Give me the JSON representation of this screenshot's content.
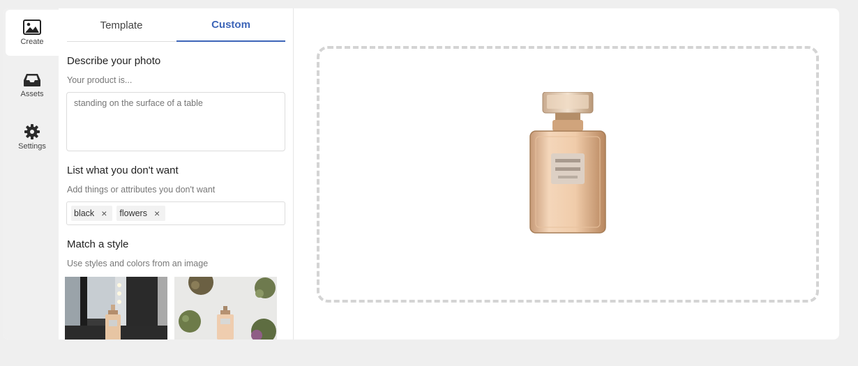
{
  "rail": {
    "items": [
      {
        "label": "Create",
        "icon": "image-icon",
        "active": true
      },
      {
        "label": "Assets",
        "icon": "inbox-icon",
        "active": false
      },
      {
        "label": "Settings",
        "icon": "gear-icon",
        "active": false
      }
    ]
  },
  "tabs": [
    {
      "label": "Template",
      "active": false
    },
    {
      "label": "Custom",
      "active": true
    }
  ],
  "describe": {
    "title": "Describe your photo",
    "subtitle": "Your product is...",
    "placeholder": "standing on the surface of a table"
  },
  "negative": {
    "title": "List what you don't want",
    "subtitle": "Add things or attributes you don't want",
    "tags": [
      "black",
      "flowers"
    ]
  },
  "style": {
    "title": "Match a style",
    "subtitle": "Use styles and colors from an image"
  },
  "colors": {
    "accent": "#3d65b8",
    "rail_bg": "#f0f0f0",
    "page_bg": "#efefef"
  }
}
